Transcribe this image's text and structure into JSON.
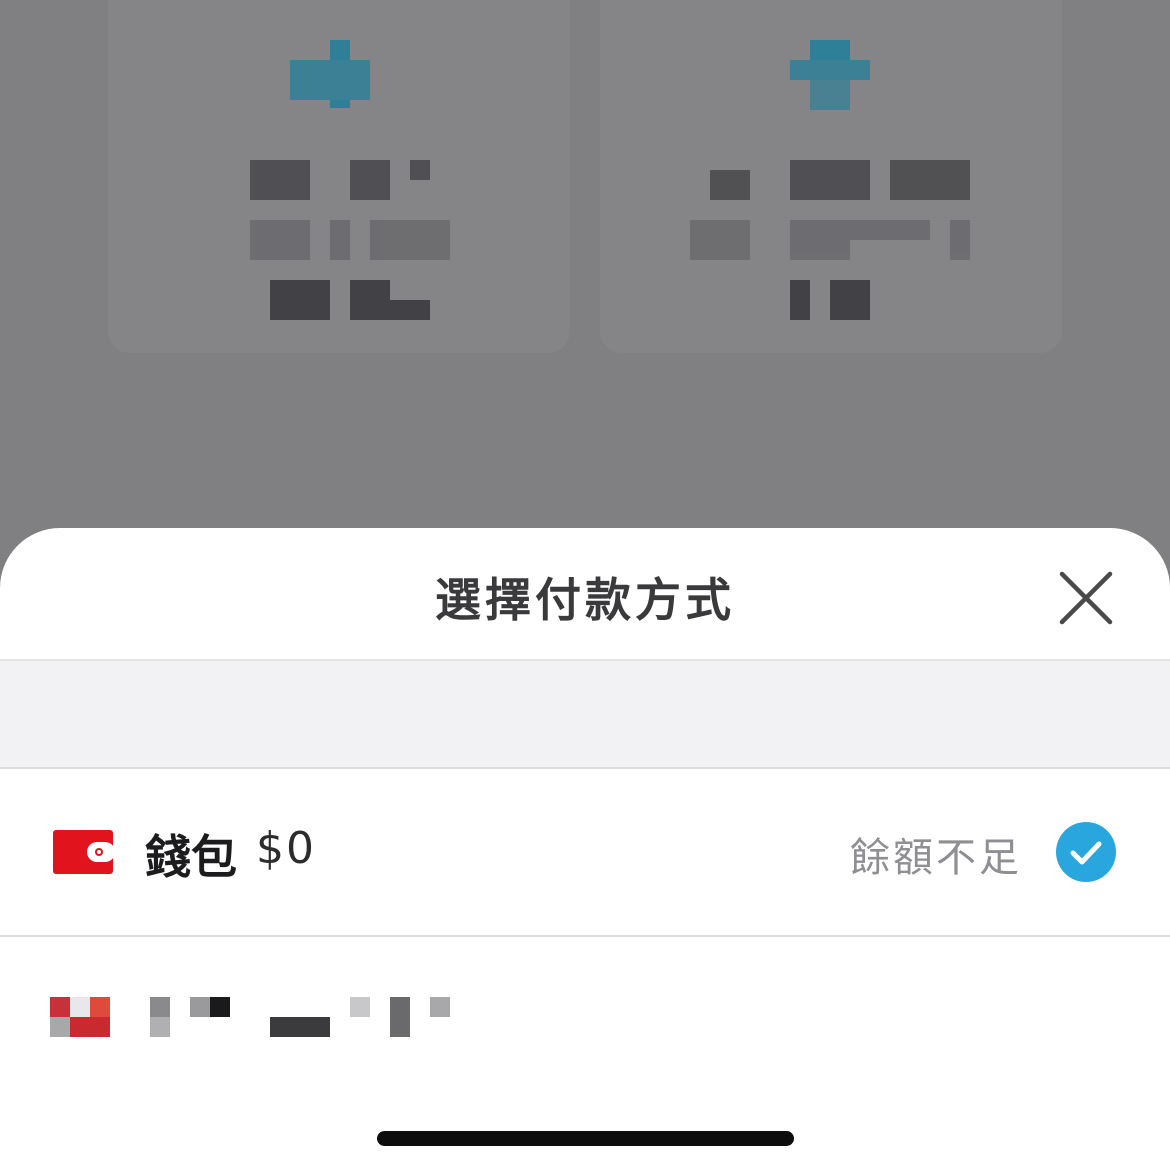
{
  "sheet": {
    "title": "選擇付款方式",
    "close_icon": "close-icon"
  },
  "payment_methods": [
    {
      "icon": "wallet-icon",
      "label": "錢包",
      "balance": "$0",
      "status": "餘額不足",
      "selected": true
    }
  ],
  "colors": {
    "accent": "#2aa6de",
    "wallet_red": "#e1141e",
    "status_gray": "#8e8e93"
  }
}
